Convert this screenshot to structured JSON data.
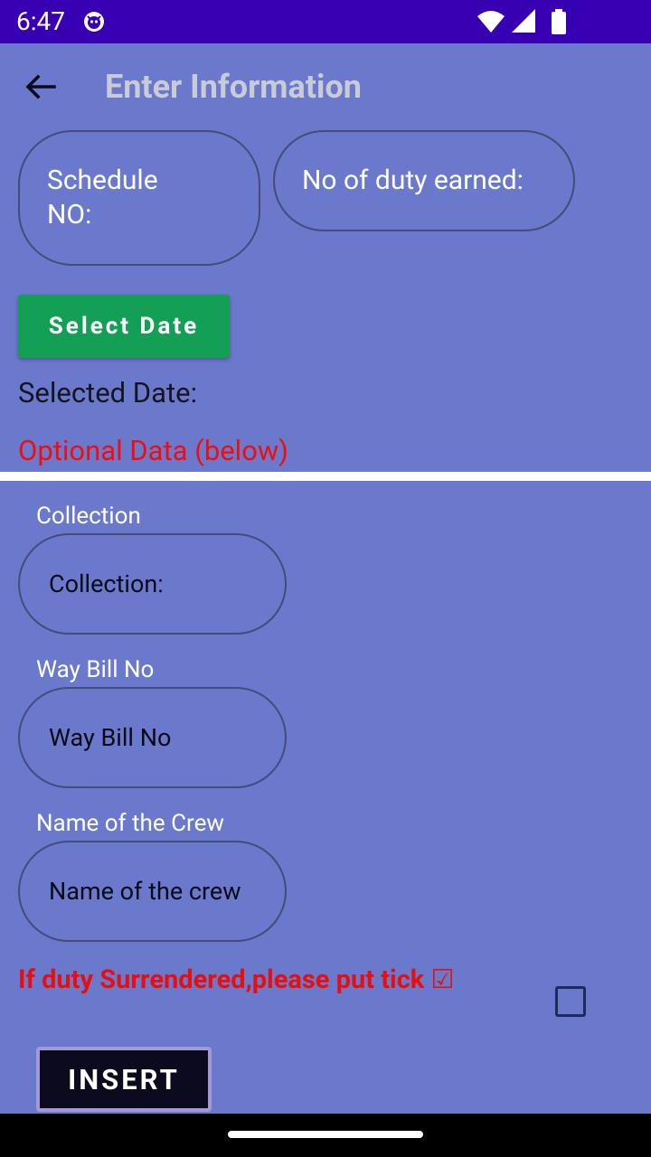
{
  "status_bar": {
    "time": "6:47",
    "icons": [
      "app-notification-icon",
      "wifi-icon",
      "signal-icon",
      "battery-icon"
    ]
  },
  "toolbar": {
    "title": "Enter Information",
    "back_icon": "arrow-back-icon"
  },
  "form": {
    "schedule_no_hint": "Schedule NO:",
    "duty_earned_hint": "No of duty earned:",
    "select_date_label": "Select Date",
    "selected_date_label": "Selected Date:",
    "optional_label": "Optional Data (below)",
    "collection_label": "Collection",
    "collection_hint": "Collection:",
    "waybill_label": "Way Bill No",
    "waybill_hint": "Way Bill No",
    "crew_label": "Name of the Crew",
    "crew_hint": "Name of the crew",
    "surrender_text": "If duty Surrendered,please put tick ☑",
    "surrender_checked": false,
    "insert_label": "INSERT"
  },
  "colors": {
    "background": "#6a79cc",
    "status_bar": "#3700b3",
    "select_date_button": "#13a055",
    "warning_text": "#f30c0c",
    "insert_button": "#0c0a1e"
  }
}
